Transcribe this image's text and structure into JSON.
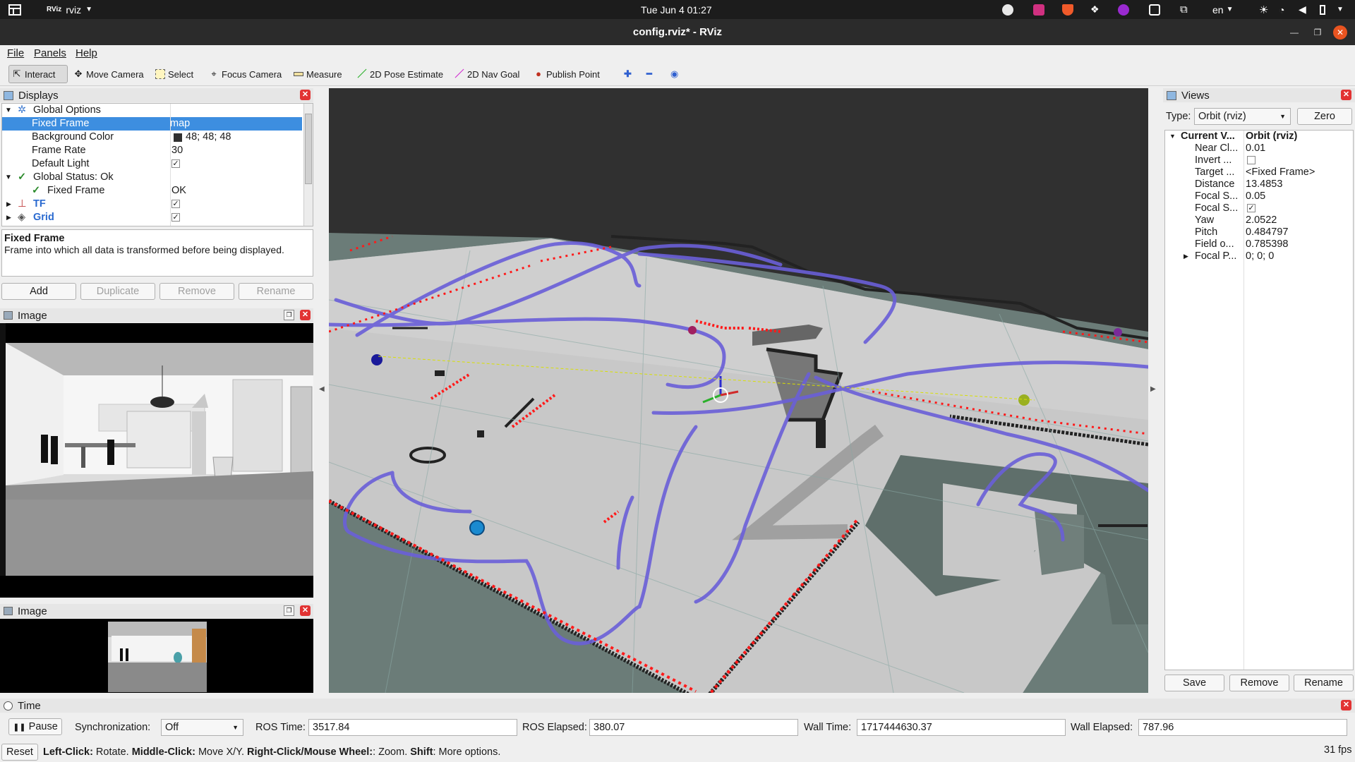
{
  "system_bar": {
    "app_name": "rviz",
    "app_logo": "RViz",
    "clock": "Tue Jun 4  01:27",
    "language": "en"
  },
  "window": {
    "title": "config.rviz* - RViz"
  },
  "menu": {
    "file": "File",
    "panels": "Panels",
    "help": "Help"
  },
  "toolbar": {
    "interact": "Interact",
    "move_camera": "Move Camera",
    "select": "Select",
    "focus_camera": "Focus Camera",
    "measure": "Measure",
    "pose_estimate": "2D Pose Estimate",
    "nav_goal": "2D Nav Goal",
    "publish_point": "Publish Point"
  },
  "displays": {
    "title": "Displays",
    "rows": {
      "global_options": "Global Options",
      "fixed_frame_key": "Fixed Frame",
      "fixed_frame_val": "map",
      "bg_color_key": "Background Color",
      "bg_color_val": "48; 48; 48",
      "frame_rate_key": "Frame Rate",
      "frame_rate_val": "30",
      "default_light_key": "Default Light",
      "global_status": "Global Status: Ok",
      "status_fixed_frame_key": "Fixed Frame",
      "status_fixed_frame_val": "OK",
      "tf": "TF",
      "grid": "Grid"
    },
    "description_title": "Fixed Frame",
    "description_text": "Frame into which all data is transformed before being displayed.",
    "buttons": {
      "add": "Add",
      "duplicate": "Duplicate",
      "remove": "Remove",
      "rename": "Rename"
    },
    "bg_color_hex": "#303030"
  },
  "image_panel_1": {
    "title": "Image"
  },
  "image_panel_2": {
    "title": "Image"
  },
  "views": {
    "title": "Views",
    "type_label": "Type:",
    "type_value": "Orbit (rviz)",
    "zero": "Zero",
    "rows": [
      {
        "key": "Current V...",
        "val": "Orbit (rviz)"
      },
      {
        "key": "Near Cl...",
        "val": "0.01"
      },
      {
        "key": "Invert ...",
        "val": ""
      },
      {
        "key": "Target ...",
        "val": "<Fixed Frame>"
      },
      {
        "key": "Distance",
        "val": "13.4853"
      },
      {
        "key": "Focal S...",
        "val": "0.05"
      },
      {
        "key": "Focal S...",
        "val": ""
      },
      {
        "key": "Yaw",
        "val": "2.0522"
      },
      {
        "key": "Pitch",
        "val": "0.484797"
      },
      {
        "key": "Field o...",
        "val": "0.785398"
      },
      {
        "key": "Focal P...",
        "val": "0; 0; 0"
      }
    ],
    "buttons": {
      "save": "Save",
      "remove": "Remove",
      "rename": "Rename"
    }
  },
  "time_panel": {
    "title": "Time",
    "pause": "Pause",
    "sync_label": "Synchronization:",
    "sync_value": "Off",
    "ros_time_label": "ROS Time:",
    "ros_time": "3517.84",
    "ros_elapsed_label": "ROS Elapsed:",
    "ros_elapsed": "380.07",
    "wall_time_label": "Wall Time:",
    "wall_time": "1717444630.37",
    "wall_elapsed_label": "Wall Elapsed:",
    "wall_elapsed": "787.96"
  },
  "status_bar": {
    "reset": "Reset",
    "left_click": "Left-Click:",
    "left_click_desc": " Rotate. ",
    "middle_click": "Middle-Click:",
    "middle_click_desc": " Move X/Y. ",
    "right_click": "Right-Click/Mouse Wheel:",
    "right_click_desc": ": Zoom. ",
    "shift": "Shift",
    "shift_desc": ": More options.",
    "fps": "31 fps"
  },
  "colors": {
    "selection": "#3d8ee0",
    "path": "#6a5fd8",
    "laser": "#ff1a1a",
    "close_button": "#e23333"
  }
}
